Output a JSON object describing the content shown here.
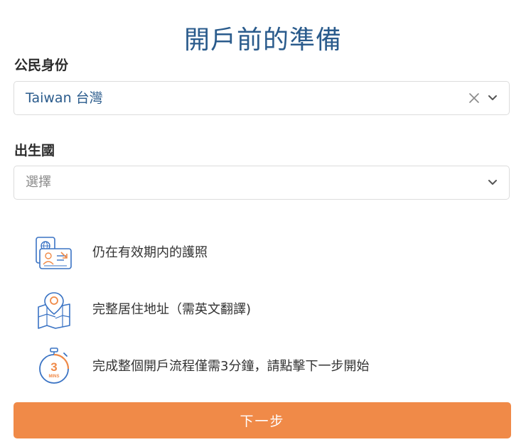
{
  "page": {
    "title": "開戶前的準備"
  },
  "citizenship": {
    "label": "公民身份",
    "selected_value": "Taiwan 台灣",
    "clear_icon": "close-icon",
    "dropdown_icon": "chevron-down-icon"
  },
  "birth_country": {
    "label": "出生國",
    "placeholder": "選擇",
    "dropdown_icon": "chevron-down-icon"
  },
  "requirements": [
    {
      "icon": "passport-icon",
      "text": "仍在有效期内的護照"
    },
    {
      "icon": "map-pin-icon",
      "text": "完整居住地址（需英文翻譯)"
    },
    {
      "icon": "stopwatch-icon",
      "text": "完成整個開戶流程僅需3分鐘，請點擊下一步開始",
      "icon_label_number": "3",
      "icon_label_unit": "MINS"
    }
  ],
  "actions": {
    "next_label": "下一步"
  },
  "colors": {
    "title": "#2a5b8c",
    "selected_text": "#2a5b8c",
    "primary_button": "#f08a48",
    "icon_blue": "#3a73c4",
    "icon_orange": "#f08a48"
  }
}
